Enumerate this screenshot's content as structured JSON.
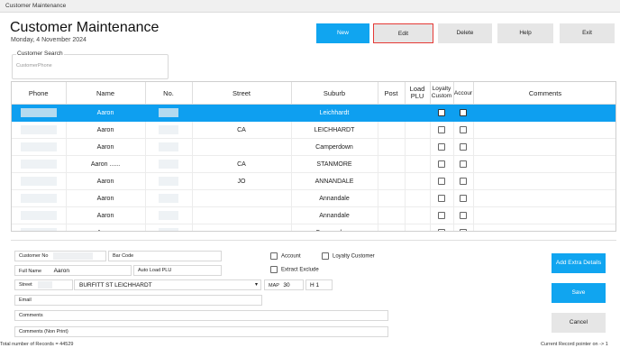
{
  "window": {
    "title": "Customer Maintenance"
  },
  "header": {
    "title": "Customer Maintenance",
    "date": "Monday, 4 November 2024"
  },
  "toolbar": {
    "new": "New",
    "edit": "Edit",
    "delete": "Delete",
    "help": "Help",
    "exit": "Exit"
  },
  "search": {
    "label": "Customer Search",
    "placeholder": "CustomerPhone"
  },
  "grid": {
    "columns": [
      "Phone",
      "Name",
      "No.",
      "Street",
      "Suburb",
      "Post",
      "Load PLU",
      "Loyalty Custom",
      "Accour",
      "Comments"
    ],
    "rows": [
      {
        "name": "Aaron",
        "street": "",
        "suburb": "Leichhardt"
      },
      {
        "name": "Aaron",
        "street": "CA",
        "suburb": "LEICHHARDT"
      },
      {
        "name": "Aaron",
        "street": "",
        "suburb": "Camperdown"
      },
      {
        "name": "Aaron ......",
        "street": "CA",
        "suburb": "STANMORE"
      },
      {
        "name": "Aaron",
        "street": "JO",
        "suburb": "ANNANDALE"
      },
      {
        "name": "Aaron",
        "street": "",
        "suburb": "Annandale"
      },
      {
        "name": "Aaron",
        "street": "",
        "suburb": "Annandale"
      },
      {
        "name": "Aaron",
        "street": "",
        "suburb": "Camperdown"
      }
    ]
  },
  "details": {
    "customer_no_label": "Customer No",
    "barcode_label": "Bar Code",
    "fullname_label": "Full Name",
    "fullname_value": "Aaron",
    "autoload_label": "Auto Load PLU",
    "street_label": "Street",
    "street_value": "BURFITT ST LEICHHARDT",
    "map_label": "MAP",
    "map_value": "30",
    "map_grid": "H 1",
    "email_label": "Email",
    "comments_label": "Comments",
    "comments_np_label": "Comments (Non Print)",
    "account_label": "Account",
    "loyalty_label": "Loyalty Customer",
    "extract_label": "Extract Exclude"
  },
  "actions": {
    "extra": "Add Extra Details",
    "save": "Save",
    "cancel": "Cancel"
  },
  "status": {
    "total": "Total number of Records = 44529",
    "pointer": "Current Record pointer on -> 1"
  }
}
